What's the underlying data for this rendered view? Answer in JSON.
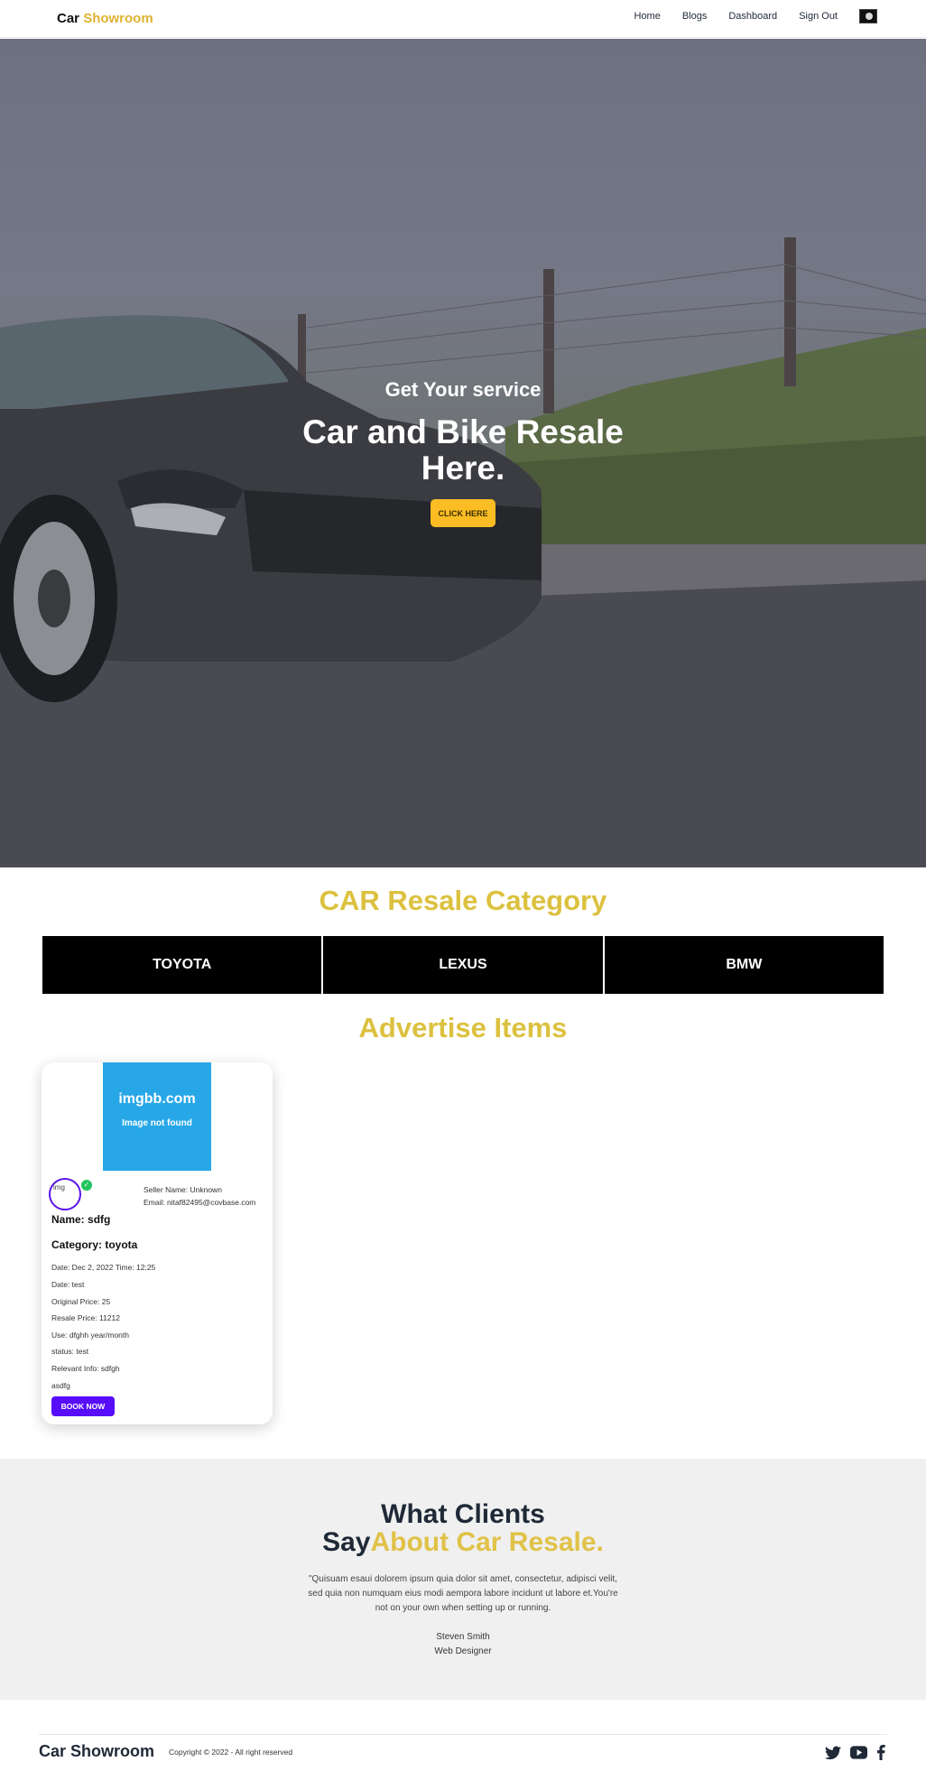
{
  "navbar": {
    "brand_first": "Car",
    "brand_second": "Showroom",
    "links": [
      "Home",
      "Blogs",
      "Dashboard",
      "Sign Out"
    ]
  },
  "hero": {
    "subtitle": "Get Your service",
    "title": "Car and Bike Resale Here.",
    "button": "CLICK HERE"
  },
  "categories": {
    "title": "CAR Resale Category",
    "items": [
      "TOYOTA",
      "LEXUS",
      "BMW"
    ]
  },
  "advertise": {
    "title": "Advertise Items",
    "item": {
      "image_brand": "imgbb.com",
      "image_message": "Image not found",
      "avatar_alt": "img",
      "seller_name": "Seller Name: Unknown",
      "seller_email": "Email: nitaf82495@covbase.com",
      "name": "Name: sdfg",
      "category": "Category: toyota",
      "date_time": "Date: Dec 2, 2022 Time: 12:25",
      "date": "Date: test",
      "original_price": "Original Price: 25",
      "resale_price": "Resale Price: 11212",
      "use": "Use: dfghh year/month",
      "status": "status: test",
      "relevant_info": "Relevant Info: sdfgh",
      "extra": "asdfg",
      "book_button": "BOOK NOW"
    }
  },
  "testimonial": {
    "heading_line1": "What Clients",
    "heading_say": "Say",
    "heading_gold": "About Car Resale.",
    "quote": "\"Quisuam esaui dolorem ipsum quia dolor sit amet, consectetur, adipisci velit, sed quia non numquam eius modi aempora labore incidunt ut labore et.You're not on your own when setting up or running.",
    "person_name": "Steven Smith",
    "person_role": "Web Designer"
  },
  "footer": {
    "brand": "Car Showroom",
    "copyright": "Copyright © 2022 - All right reserved",
    "socials": [
      "twitter-icon",
      "youtube-icon",
      "facebook-icon"
    ]
  },
  "colors": {
    "gold": "#dcc13f",
    "hero_button": "#fbbd23",
    "primary": "#570df8",
    "image_placeholder": "#27a7e7"
  }
}
